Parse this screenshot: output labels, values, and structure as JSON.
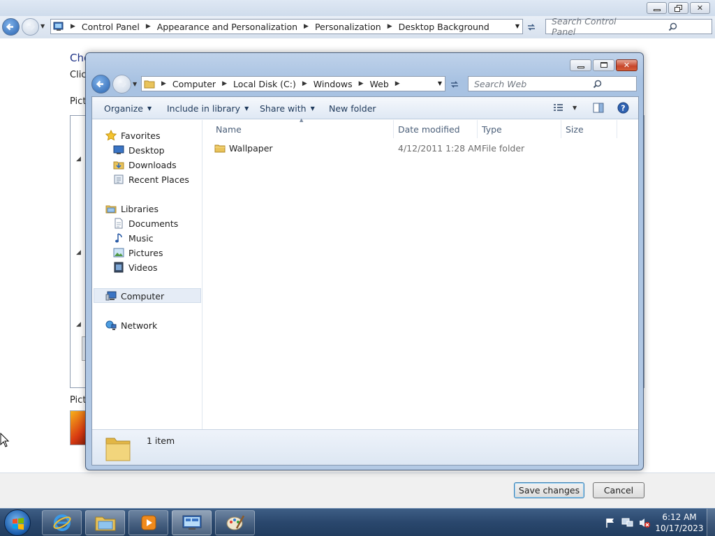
{
  "control_panel": {
    "breadcrumb": [
      "Control Panel",
      "Appearance and Personalization",
      "Personalization",
      "Desktop Background"
    ],
    "search_placeholder": "Search Control Panel",
    "heading_partial": "Cho",
    "subtext_partial": "Click",
    "picture_location_partial": "Pict",
    "picture_position_partial": "Pictu",
    "save_label": "Save changes",
    "cancel_label": "Cancel"
  },
  "dialog": {
    "breadcrumb": [
      "Computer",
      "Local Disk (C:)",
      "Windows",
      "Web"
    ],
    "search_placeholder": "Search Web",
    "toolbar": {
      "organize": "Organize",
      "include_in_library": "Include in library",
      "share_with": "Share with",
      "new_folder": "New folder"
    },
    "nav": {
      "favorites": "Favorites",
      "desktop": "Desktop",
      "downloads": "Downloads",
      "recent_places": "Recent Places",
      "libraries": "Libraries",
      "documents": "Documents",
      "music": "Music",
      "pictures": "Pictures",
      "videos": "Videos",
      "computer": "Computer",
      "network": "Network"
    },
    "columns": {
      "name": "Name",
      "date_modified": "Date modified",
      "type": "Type",
      "size": "Size"
    },
    "files": [
      {
        "name": "Wallpaper",
        "date_modified": "4/12/2011 1:28 AM",
        "type": "File folder",
        "size": ""
      }
    ],
    "status": "1 item"
  },
  "taskbar": {
    "time": "6:12 AM",
    "date": "10/17/2023",
    "pinned": [
      "start-orb",
      "internet-explorer-icon",
      "windows-explorer-icon",
      "media-player-icon",
      "control-panel-icon",
      "paint-icon"
    ]
  }
}
